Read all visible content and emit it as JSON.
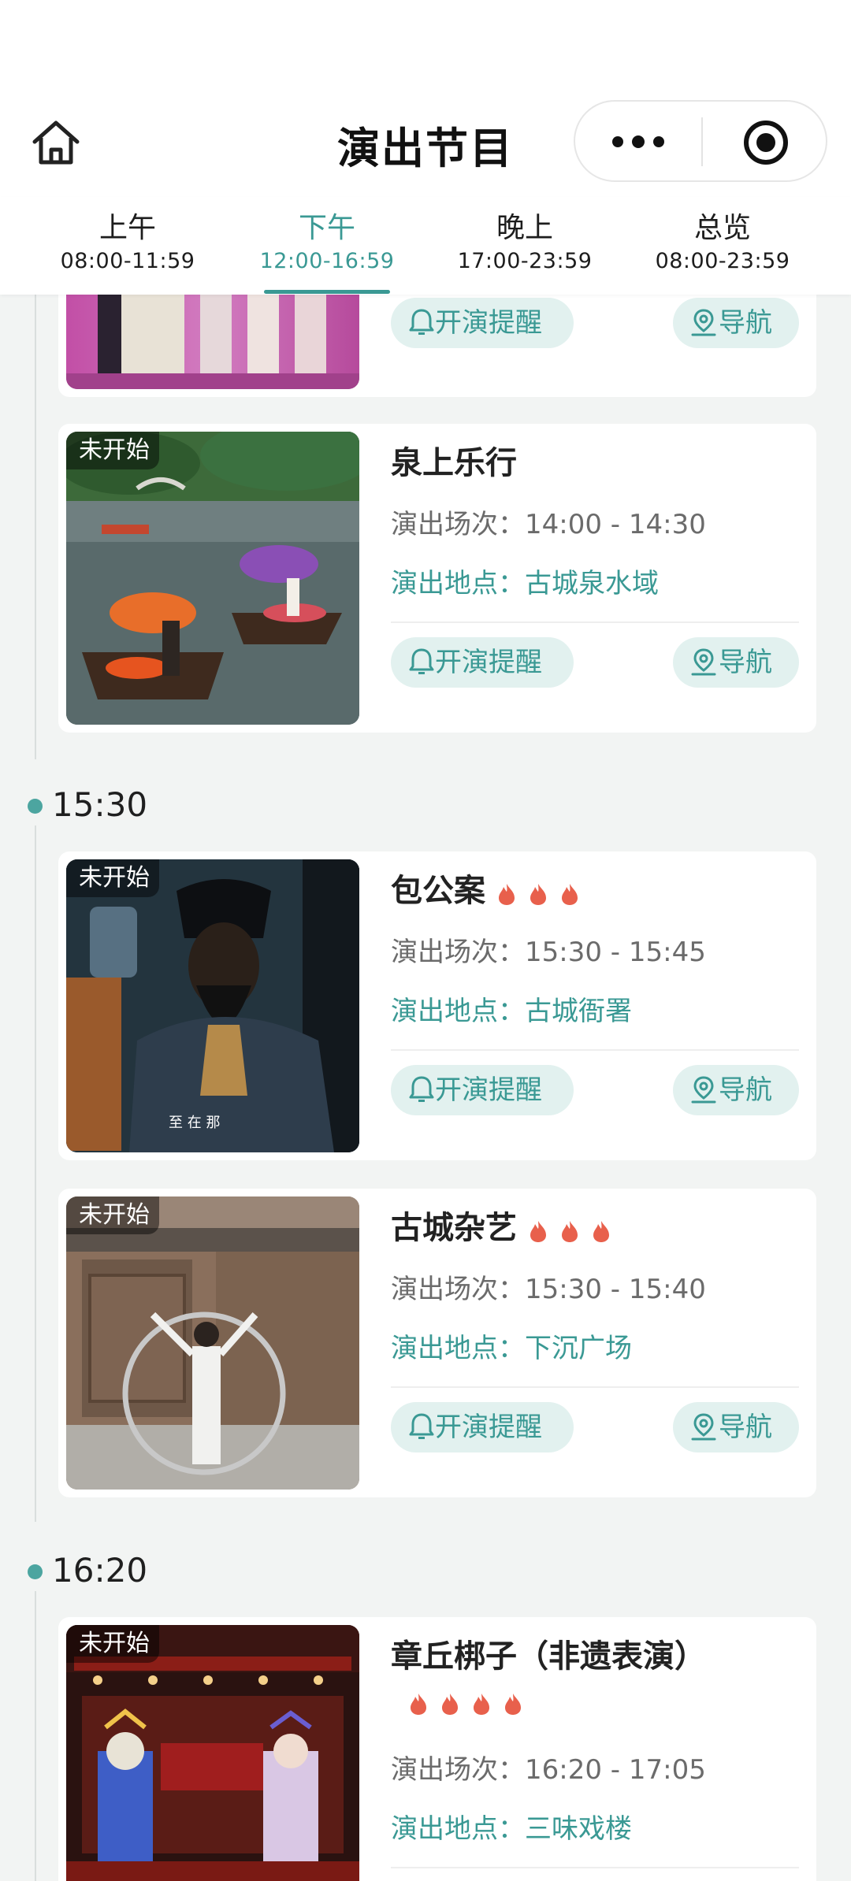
{
  "header": {
    "title": "演出节目"
  },
  "tabs": [
    {
      "name": "上午",
      "time": "08:00-11:59"
    },
    {
      "name": "下午",
      "time": "12:00-16:59"
    },
    {
      "name": "晚上",
      "time": "17:00-23:59"
    },
    {
      "name": "总览",
      "time": "08:00-23:59"
    }
  ],
  "active_tab": "下午",
  "labels": {
    "status_not_started": "未开始",
    "session_prefix": "演出场次：",
    "location_prefix": "演出地点：",
    "remind_button": "开演提醒",
    "nav_button": "导航"
  },
  "groups": [
    {
      "time": "15:30"
    },
    {
      "time": "16:20"
    }
  ],
  "programs": [
    {
      "status": "未开始",
      "title": "泉上乐行",
      "heat": 0,
      "session": "14:00 - 14:30",
      "location": "古城泉水域"
    },
    {
      "status": "未开始",
      "title": "包公案",
      "heat": 3,
      "session": "15:30 - 15:45",
      "location": "古城衙署"
    },
    {
      "status": "未开始",
      "title": "古城杂艺",
      "heat": 3,
      "session": "15:30 - 15:40",
      "location": "下沉广场"
    },
    {
      "status": "未开始",
      "title": "章丘梆子（非遗表演）",
      "heat": 4,
      "session": "16:20 - 17:05",
      "location": "三味戏楼"
    }
  ],
  "colors": {
    "accent": "#3a9994",
    "pill_bg": "#e2f1ef",
    "page_bg": "#f2f4f3",
    "fire": "#e8604c"
  },
  "icons": {
    "home": "home-icon",
    "more": "more-dots-icon",
    "target": "target-icon",
    "bell": "bell-icon",
    "navigate": "location-pin-icon",
    "fire": "fire-icon"
  }
}
